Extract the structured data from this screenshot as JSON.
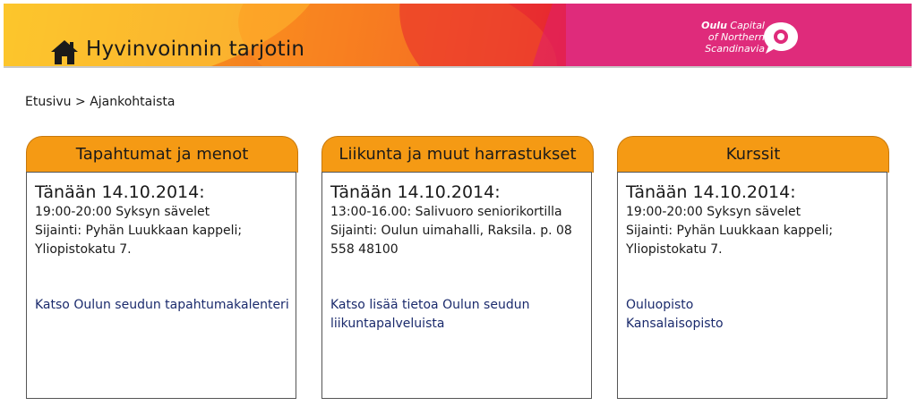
{
  "header": {
    "title": "Hyvinvoinnin tarjotin",
    "logo": {
      "name": "Oulu",
      "line1": "Capital",
      "line2": "of Northern",
      "line3": "Scandinavia"
    }
  },
  "breadcrumb": {
    "home": "Etusivu",
    "separator": ">",
    "current": "Ajankohtaista"
  },
  "cards": [
    {
      "title": "Tapahtumat ja menot",
      "date": "Tänään 14.10.2014:",
      "lines": [
        "19:00-20:00 Syksyn sävelet",
        "Sijainti: Pyhän Luukkaan kappeli;",
        "Yliopistokatu 7."
      ],
      "links": [
        "Katso Oulun seudun tapahtumakalenteri"
      ]
    },
    {
      "title": "Liikunta ja muut harrastukset",
      "date": "Tänään 14.10.2014:",
      "lines": [
        "13:00-16.00: Salivuoro seniorikortilla",
        "Sijainti: Oulun uimahalli, Raksila. p. 08",
        "558 48100"
      ],
      "links": [
        "Katso lisää tietoa Oulun seudun",
        "liikuntapalveluista"
      ]
    },
    {
      "title": "Kurssit",
      "date": "Tänään 14.10.2014:",
      "lines": [
        "19:00-20:00 Syksyn sävelet",
        "Sijainti: Pyhän Luukkaan kappeli;",
        "Yliopistokatu 7."
      ],
      "links": [
        "Ouluopisto",
        "Kansalaisopisto"
      ]
    }
  ],
  "colors": {
    "tab": "#f59a14",
    "header_pink": "#df2b7b",
    "link": "#1a2a6c"
  },
  "icons": {
    "home": "home-icon",
    "logo": "speech-bubble-logo-icon"
  }
}
